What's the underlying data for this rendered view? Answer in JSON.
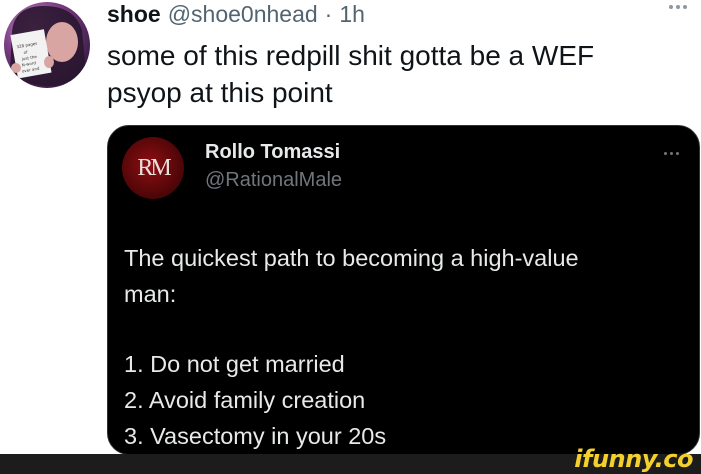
{
  "tweet": {
    "display_name": "shoe",
    "handle": "@shoe0nhead",
    "time_separator": "·",
    "time": "1h",
    "text": "some of this redpill shit gotta be a WEF\npsyop at this point",
    "avatar_sign_text": "328 pages of just the N-word over and over again"
  },
  "quote": {
    "display_name": "Rollo Tomassi",
    "handle": "@RationalMale",
    "avatar_logo": "RM",
    "lines": [
      "The quickest path to becoming a high-value",
      "man:",
      "",
      "1. Do not get married",
      "2. Avoid family creation",
      "3. Vasectomy in your 20s"
    ]
  },
  "watermark": "ifunny.co",
  "colors": {
    "background": "#ffffff",
    "card_background": "#000000",
    "primary_text": "#0f1419",
    "secondary_text": "#536471",
    "watermark": "#f4d02c"
  },
  "icons": {
    "more": "more-horizontal-icon"
  }
}
